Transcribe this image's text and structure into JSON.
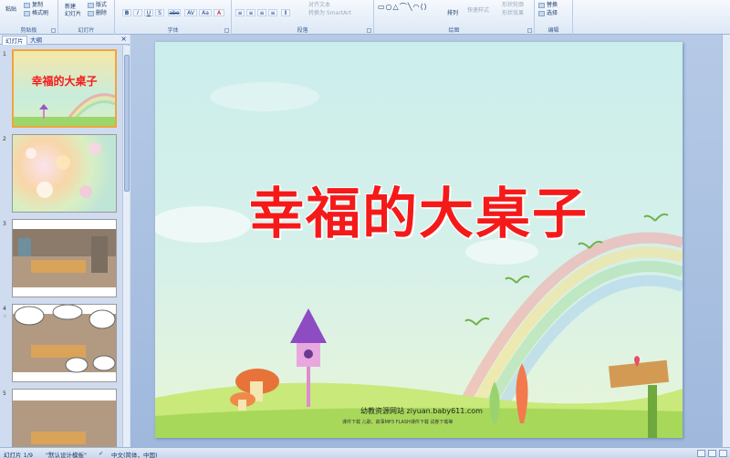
{
  "ribbon": {
    "clipboard": {
      "paste": "粘贴",
      "copy": "复制",
      "format_painter": "格式刷",
      "label": "剪贴板"
    },
    "slides": {
      "new_slide_line1": "新建",
      "new_slide_line2": "幻灯片",
      "layout": "版式",
      "reset": "重设",
      "delete": "删除",
      "label": "幻灯片"
    },
    "font": {
      "bold": "B",
      "italic": "I",
      "underline": "U",
      "shadow": "S",
      "strike": "abe",
      "spacing": "AV",
      "case": "Aa",
      "color": "A",
      "label": "字体"
    },
    "paragraph": {
      "align_text": "对齐文本",
      "convert_smartart": "转换为 SmartArt",
      "label": "段落"
    },
    "drawing": {
      "arrange": "排列",
      "quick_styles": "快速样式",
      "shape_outline": "形状轮廓",
      "shape_effects": "形状效果",
      "label": "绘图"
    },
    "editing": {
      "replace": "替换",
      "select": "选择",
      "label": "编辑"
    }
  },
  "left_panel": {
    "tab_slides": "幻灯片",
    "tab_outline": "大纲",
    "close": "×",
    "thumbnails": [
      {
        "num": "1",
        "title": "幸福的大桌子"
      },
      {
        "num": "2"
      },
      {
        "num": "3"
      },
      {
        "num": "4",
        "star": "☆"
      },
      {
        "num": "5"
      }
    ]
  },
  "slide": {
    "title": "幸福的大桌子",
    "site_name": "幼教资源网站  ziyuan.baby611.com",
    "site_sub": "课件下载    儿歌、故事MP3    FLASH课件下载    试卷下载等"
  },
  "statusbar": {
    "slide_pos": "幻灯片 1/9",
    "theme": "\"默认设计模板\"",
    "language": "中文(简体，中国)"
  },
  "colors": {
    "title_red": "#f51a1a",
    "ribbon_bg": "#dde8f6",
    "canvas_bg": "#a9c0e0",
    "selected_thumb": "#f1a43c"
  }
}
